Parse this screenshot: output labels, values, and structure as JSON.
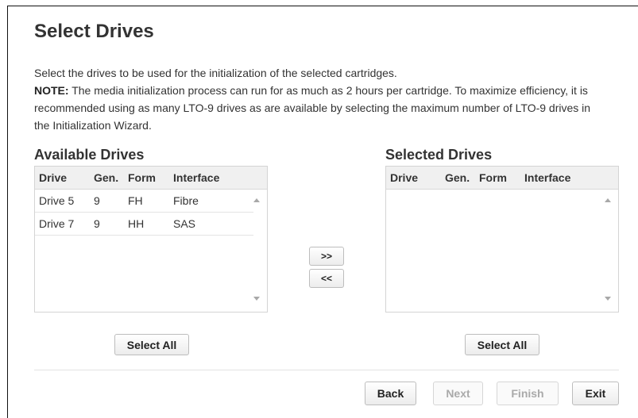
{
  "page": {
    "title": "Select Drives",
    "description": "Select the drives to be used for the initialization of the selected cartridges.",
    "note_label": "NOTE:",
    "note_text": " The media initialization process can run for as much as 2 hours per cartridge. To maximize efficiency, it is recommended using as many LTO-9 drives as are available by selecting the maximum number of LTO-9 drives in the Initialization Wizard."
  },
  "available": {
    "title": "Available Drives",
    "columns": [
      "Drive",
      "Gen.",
      "Form",
      "Interface"
    ],
    "rows": [
      {
        "drive": "Drive 5",
        "gen": "9",
        "form": "FH",
        "interface": "Fibre"
      },
      {
        "drive": "Drive 7",
        "gen": "9",
        "form": "HH",
        "interface": "SAS"
      }
    ],
    "select_all": "Select All"
  },
  "selected": {
    "title": "Selected Drives",
    "columns": [
      "Drive",
      "Gen.",
      "Form",
      "Interface"
    ],
    "rows": [],
    "select_all": "Select All"
  },
  "transfer": {
    "add": ">>",
    "remove": "<<"
  },
  "footer": {
    "back": "Back",
    "next": "Next",
    "finish": "Finish",
    "exit": "Exit"
  }
}
